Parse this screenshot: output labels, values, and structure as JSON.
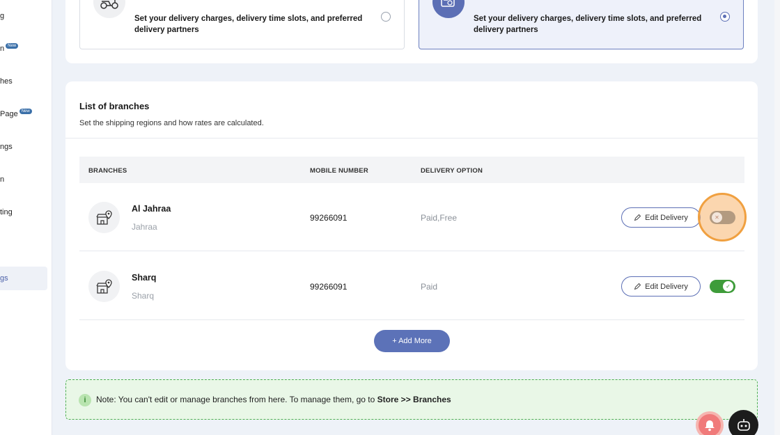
{
  "sidebar": {
    "items": [
      {
        "label": "g",
        "new": false
      },
      {
        "label": "n",
        "new": true
      },
      {
        "label": "hes",
        "new": false
      },
      {
        "label": "Page",
        "new": true
      },
      {
        "label": "ngs",
        "new": false
      },
      {
        "label": "n",
        "new": false
      },
      {
        "label": "ting",
        "new": false
      }
    ],
    "active_label": "gs",
    "new_badge": "New"
  },
  "delivery_options": [
    {
      "text": "Set your delivery charges, delivery time slots, and preferred delivery partners",
      "selected": false,
      "icon": "scooter-icon"
    },
    {
      "text": "Set your delivery charges, delivery time slots, and preferred delivery partners",
      "selected": true,
      "icon": "delivery-truck-icon"
    }
  ],
  "branches_section": {
    "title": "List of branches",
    "subtitle": "Set the shipping regions and how rates are calculated.",
    "columns": [
      "BRANCHES",
      "MOBILE NUMBER",
      "DELIVERY OPTION"
    ],
    "rows": [
      {
        "name": "Al Jahraa",
        "city": "Jahraa",
        "mobile": "99266091",
        "delivery": "Paid,Free",
        "edit_label": "Edit Delivery",
        "enabled": false
      },
      {
        "name": "Sharq",
        "city": "Sharq",
        "mobile": "99266091",
        "delivery": "Paid",
        "edit_label": "Edit Delivery",
        "enabled": true
      }
    ],
    "add_more_label": "+ Add More"
  },
  "note": {
    "icon": "i",
    "prefix": "Note: You can't edit or manage branches from here. To manage them, go to",
    "path": "Store >> Branches"
  },
  "colors": {
    "accent": "#5c72b8",
    "toggle_on": "#3e9c3a",
    "toggle_off": "#b39a80",
    "highlight": "#f0a040",
    "note_border": "#4caf50"
  }
}
